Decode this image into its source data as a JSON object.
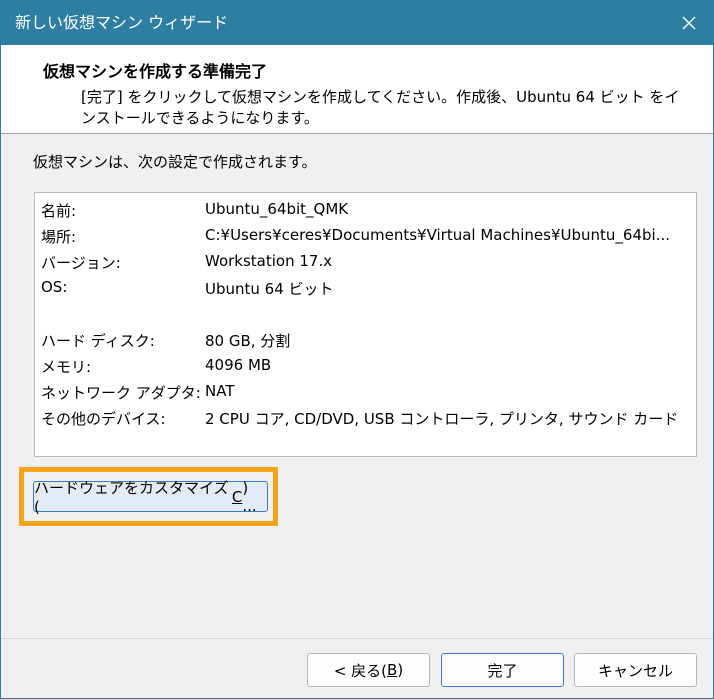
{
  "window": {
    "title": "新しい仮想マシン ウィザード"
  },
  "header": {
    "title": "仮想マシンを作成する準備完了",
    "description": "[完了] をクリックして仮想マシンを作成してください。作成後、Ubuntu 64 ビット をインストールできるようになります。"
  },
  "intro": "仮想マシンは、次の設定で作成されます。",
  "summary": {
    "rows": [
      {
        "key": "名前:",
        "value": "Ubuntu_64bit_QMK"
      },
      {
        "key": "場所:",
        "value": "C:¥Users¥ceres¥Documents¥Virtual Machines¥Ubuntu_64bi..."
      },
      {
        "key": "バージョン:",
        "value": "Workstation 17.x"
      },
      {
        "key": "OS:",
        "value": "Ubuntu 64 ビット"
      },
      {
        "key": "ハード ディスク:",
        "value": "80 GB, 分割"
      },
      {
        "key": "メモリ:",
        "value": "4096 MB"
      },
      {
        "key": "ネットワーク アダプタ:",
        "value": "NAT"
      },
      {
        "key": "その他のデバイス:",
        "value": "2 CPU コア, CD/DVD, USB コントローラ, プリンタ, サウンド カード"
      }
    ]
  },
  "buttons": {
    "customize_prefix": "ハードウェアをカスタマイズ(",
    "customize_key": "C",
    "customize_suffix": ") ...",
    "back_prefix": "< 戻る(",
    "back_key": "B",
    "back_suffix": ")",
    "finish": "完了",
    "cancel": "キャンセル"
  },
  "colors": {
    "titlebar": "#2e7ea1",
    "highlight": "#f5a31a"
  },
  "icons": {
    "close": "close-icon"
  }
}
